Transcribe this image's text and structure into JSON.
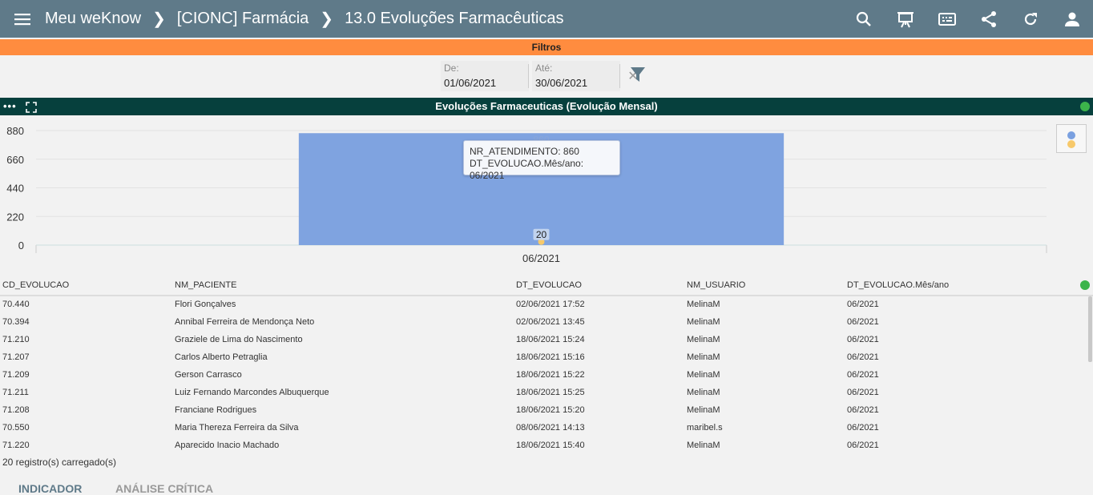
{
  "header": {
    "breadcrumbs": [
      "Meu weKnow",
      "[CIONC] Farmácia",
      "13.0 Evoluções Farmacêuticas"
    ],
    "icons": [
      "menu-icon",
      "search-icon",
      "presentation-icon",
      "subtitles-icon",
      "share-icon",
      "refresh-icon",
      "user-icon"
    ]
  },
  "filters": {
    "title": "Filtros",
    "from_label": "De:",
    "from_value": "01/06/2021",
    "to_label": "Até:",
    "to_value": "30/06/2021",
    "clear_symbol": "✕"
  },
  "panel": {
    "title": "Evoluções Farmaceuticas (Evolução Mensal)",
    "dots": "•••"
  },
  "chart_data": {
    "type": "bar",
    "categories": [
      "06/2021"
    ],
    "series": [
      {
        "name": "NR_ATENDIMENTO",
        "values": [
          860
        ],
        "color": "#7fa3e0"
      },
      {
        "name": "",
        "values": [
          20
        ],
        "color": "#f7c96b"
      }
    ],
    "yticks": [
      0,
      220,
      440,
      660,
      880
    ],
    "ylim": [
      0,
      880
    ],
    "data_label": "20",
    "hidden_label": "860",
    "tooltip": {
      "line1": "NR_ATENDIMENTO: 860",
      "line2": "DT_EVOLUCAO.Mês/ano: 06/2021"
    }
  },
  "table": {
    "columns": [
      "CD_EVOLUCAO",
      "NM_PACIENTE",
      "DT_EVOLUCAO",
      "NM_USUARIO",
      "DT_EVOLUCAO.Mês/ano"
    ],
    "rows": [
      [
        "70.440",
        "Flori Gonçalves",
        "02/06/2021 17:52",
        "MelinaM",
        "06/2021"
      ],
      [
        "70.394",
        "Annibal Ferreira de Mendonça Neto",
        "02/06/2021 13:45",
        "MelinaM",
        "06/2021"
      ],
      [
        "71.210",
        "Graziele de Lima do Nascimento",
        "18/06/2021 15:24",
        "MelinaM",
        "06/2021"
      ],
      [
        "71.207",
        "Carlos Alberto Petraglia",
        "18/06/2021 15:16",
        "MelinaM",
        "06/2021"
      ],
      [
        "71.209",
        "Gerson Carrasco",
        "18/06/2021 15:22",
        "MelinaM",
        "06/2021"
      ],
      [
        "71.211",
        "Luiz Fernando Marcondes Albuquerque",
        "18/06/2021 15:25",
        "MelinaM",
        "06/2021"
      ],
      [
        "71.208",
        "Franciane Rodrigues",
        "18/06/2021 15:20",
        "MelinaM",
        "06/2021"
      ],
      [
        "70.550",
        "Maria Thereza Ferreira da Silva",
        "08/06/2021 14:13",
        "maribel.s",
        "06/2021"
      ],
      [
        "71.220",
        "Aparecido Inacio Machado",
        "18/06/2021 15:40",
        "MelinaM",
        "06/2021"
      ]
    ],
    "footer": "20 registro(s) carregado(s)"
  },
  "tabs": [
    "INDICADOR",
    "ANÁLISE CRÍTICA"
  ],
  "colors": {
    "header_bg": "#5f7a89",
    "filters_bar": "#ff8c3f",
    "panel_header": "#06403d",
    "status_green": "#3cb44b"
  }
}
